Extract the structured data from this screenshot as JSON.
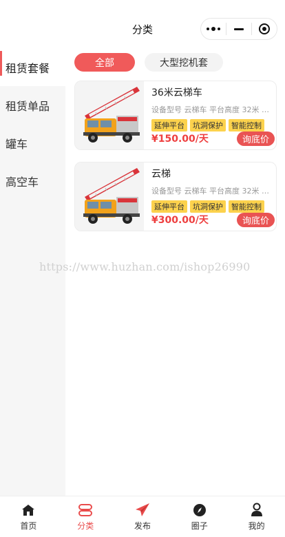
{
  "header": {
    "title": "分类"
  },
  "capsule": {
    "more_icon": "more-dots-icon",
    "minimize_icon": "minimize-icon",
    "close_icon": "target-icon"
  },
  "sidebar": {
    "items": [
      {
        "label": "租赁套餐",
        "active": true
      },
      {
        "label": "租赁单品",
        "active": false
      },
      {
        "label": "罐车",
        "active": false
      },
      {
        "label": "高空车",
        "active": false
      }
    ]
  },
  "filters": [
    {
      "label": "全部",
      "active": true
    },
    {
      "label": "大型挖机套",
      "active": false
    }
  ],
  "products": [
    {
      "title": "36米云梯车",
      "specs": "设备型号 云梯车 平台高度 32米 专…",
      "tags": [
        "延伸平台",
        "坑洞保护",
        "智能控制"
      ],
      "price": "¥150.00/天",
      "button": "询底价"
    },
    {
      "title": "云梯",
      "specs": "设备型号 云梯车 平台高度 32米 专…",
      "tags": [
        "延伸平台",
        "坑洞保护",
        "智能控制"
      ],
      "price": "¥300.00/天",
      "button": "询底价"
    }
  ],
  "watermark": "https://www.huzhan.com/ishop26990",
  "tabbar": [
    {
      "label": "首页",
      "icon": "home-icon",
      "active": false
    },
    {
      "label": "分类",
      "icon": "category-icon",
      "active": true
    },
    {
      "label": "发布",
      "icon": "send-icon",
      "active": false
    },
    {
      "label": "圈子",
      "icon": "compass-icon",
      "active": false
    },
    {
      "label": "我的",
      "icon": "user-icon",
      "active": false
    }
  ],
  "colors": {
    "accent": "#f05a5a",
    "price": "#ee3f3f",
    "tag": "#fcd24d",
    "sidebar_bg": "#f6f6f6"
  }
}
